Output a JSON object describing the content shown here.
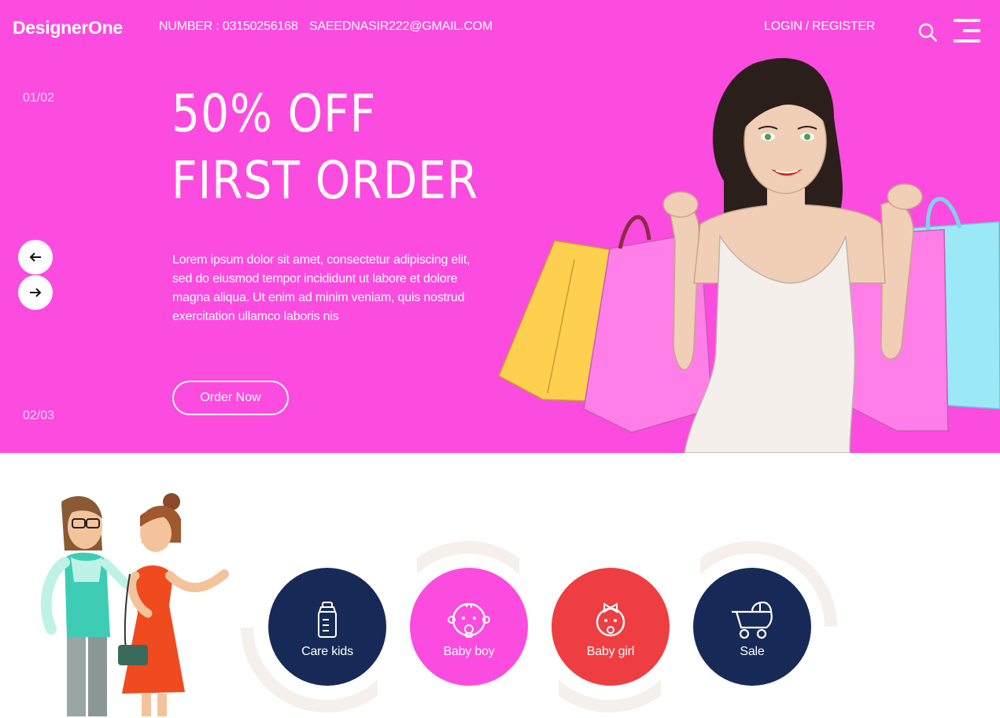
{
  "colors": {
    "hero_background": "#fc4bdf",
    "navy": "#172a57",
    "pink": "#fc4bdf",
    "red": "#ee3e42",
    "ring": "#f5f0ec"
  },
  "header": {
    "logo": "DesignerOne",
    "phone": "NUMBER : 03150256168",
    "email": "SAEEDNASIR222@GMAIL.COM",
    "login": "LOGIN",
    "separator": "/",
    "register": "REGISTER",
    "search_icon": "search-icon",
    "menu_icon": "hamburger-menu-icon"
  },
  "hero": {
    "counter_top": "01/02",
    "counter_bottom": "02/03",
    "headline_line1": "50% OFF",
    "headline_line2": "FIRST ORDER",
    "body": "Lorem ipsum dolor sit amet, consectetur adipiscing elit, sed do eiusmod tempor incididunt ut labore et dolore magna aliqua. Ut enim ad minim veniam, quis nostrud exercitation ullamco laboris nis",
    "cta": "Order Now",
    "prev_icon": "arrow-left-icon",
    "next_icon": "arrow-right-icon"
  },
  "categories": [
    {
      "label": "Care kids",
      "icon": "baby-bottle-icon",
      "color": "#172a57"
    },
    {
      "label": "Baby boy",
      "icon": "baby-boy-face-icon",
      "color": "#fc4bdf"
    },
    {
      "label": "Baby girl",
      "icon": "baby-girl-face-icon",
      "color": "#ee3e42"
    },
    {
      "label": "Sale",
      "icon": "baby-stroller-icon",
      "color": "#172a57"
    }
  ]
}
